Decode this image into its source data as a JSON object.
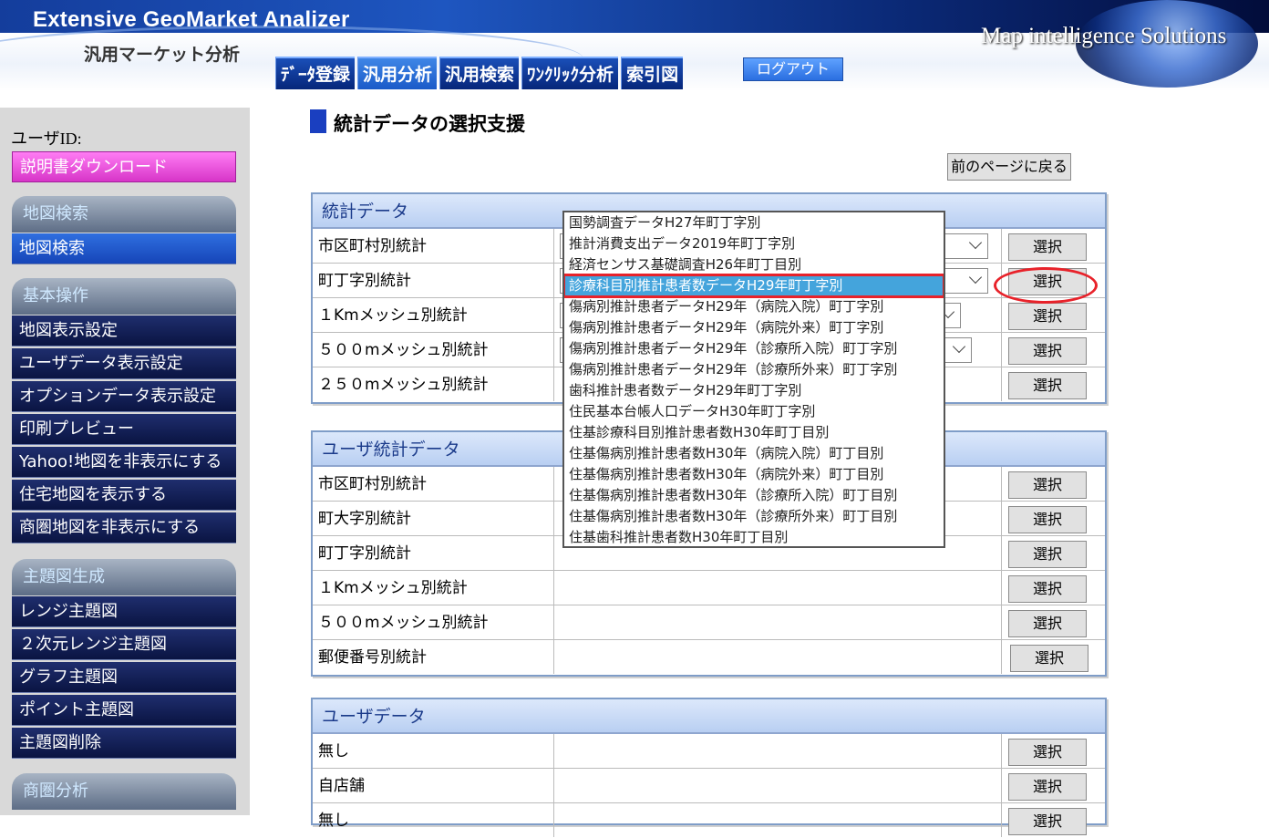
{
  "header": {
    "app_title": "Extensive GeoMarket Analizer",
    "app_subtitle": "汎用マーケット分析",
    "brand": "Map intelligence Solutions",
    "tabs": [
      "ﾃﾞｰﾀ登録",
      "汎用分析",
      "汎用検索",
      "ﾜﾝｸﾘｯｸ分析",
      "索引図"
    ],
    "active_tab": "汎用分析",
    "logout_label": "ログアウト"
  },
  "sidebar": {
    "user_id_label": "ユーザID:",
    "manual_download": "説明書ダウンロード",
    "sections": [
      {
        "title": "地図検索",
        "items": [
          "地図検索"
        ]
      },
      {
        "title": "基本操作",
        "items": [
          "地図表示設定",
          "ユーザデータ表示設定",
          "オプションデータ表示設定",
          "印刷プレビュー",
          "Yahoo!地図を非表示にする",
          "住宅地図を表示する",
          "商圏地図を非表示にする"
        ]
      },
      {
        "title": "主題図生成",
        "items": [
          "レンジ主題図",
          "２次元レンジ主題図",
          "グラフ主題図",
          "ポイント主題図",
          "主題図削除"
        ]
      },
      {
        "title": "商圏分析",
        "items": []
      }
    ]
  },
  "main": {
    "page_title": "統計データの選択支援",
    "back_button": "前のページに戻る",
    "select_label": "選択",
    "panels": [
      {
        "title": "統計データ",
        "rows": [
          "市区町村別統計",
          "町丁字別統計",
          "１Kmメッシュ別統計",
          "５００mメッシュ別統計",
          "２５０mメッシュ別統計"
        ]
      },
      {
        "title": "ユーザ統計データ",
        "rows": [
          "市区町村別統計",
          "町大字別統計",
          "町丁字別統計",
          "１Kmメッシュ別統計",
          "５００mメッシュ別統計",
          "郵便番号別統計"
        ]
      },
      {
        "title": "ユーザデータ",
        "rows": [
          "無し",
          "自店舗",
          "無し"
        ]
      }
    ]
  },
  "dropdown": {
    "options": [
      "国勢調査データH27年町丁字別",
      "推計消費支出データ2019年町丁字別",
      "経済センサス基礎調査H26年町丁目別",
      "診療科目別推計患者数データH29年町丁字別",
      "傷病別推計患者データH29年（病院入院）町丁字別",
      "傷病別推計患者データH29年（病院外来）町丁字別",
      "傷病別推計患者データH29年（診療所入院）町丁字別",
      "傷病別推計患者データH29年（診療所外来）町丁字別",
      "歯科推計患者数データH29年町丁字別",
      "住民基本台帳人口データH30年町丁字別",
      "住基診療科目別推計患者数H30年町丁目別",
      "住基傷病別推計患者数H30年（病院入院）町丁目別",
      "住基傷病別推計患者数H30年（病院外来）町丁目別",
      "住基傷病別推計患者数H30年（診療所入院）町丁目別",
      "住基傷病別推計患者数H30年（診療所外来）町丁目別",
      "住基歯科推計患者数H30年町丁目別"
    ],
    "selected_index": 3
  },
  "colors": {
    "highlight": "#44a4dc",
    "annotation_red": "#e8222a",
    "accent_blue": "#1a3fc0"
  }
}
